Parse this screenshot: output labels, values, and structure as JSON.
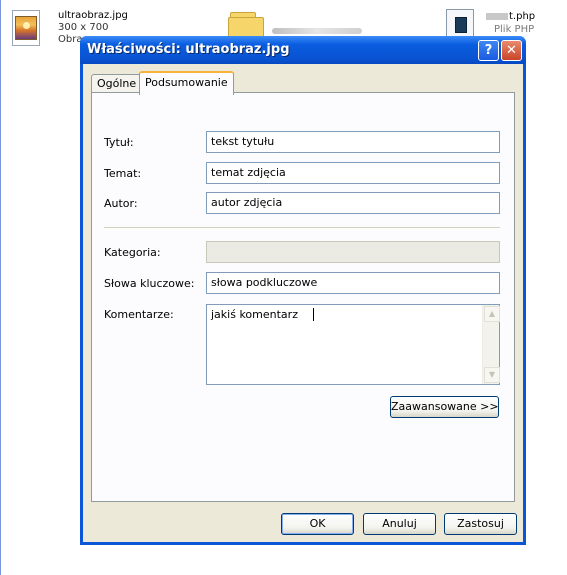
{
  "desktop": {
    "file_name": "ultraobraz.jpg",
    "file_dims": "300 x 700",
    "file_type_partial": "Obra",
    "php_name_visible": "t.php",
    "php_type": "Plik PHP"
  },
  "dialog": {
    "title": "Właściwości: ultraobraz.jpg",
    "help_label": "?",
    "close_label": "✕",
    "tabs": [
      {
        "label": "Ogólne"
      },
      {
        "label": "Podsumowanie"
      }
    ],
    "fields": {
      "title_label": "Tytuł:",
      "title_value": "tekst tytułu",
      "subject_label": "Temat:",
      "subject_value": "temat zdjęcia",
      "author_label": "Autor:",
      "author_value": "autor zdjęcia",
      "category_label": "Kategoria:",
      "category_value": "",
      "keywords_label": "Słowa kluczowe:",
      "keywords_value": "słowa podkluczowe",
      "comments_label": "Komentarze:",
      "comments_value": "jakiś komentarz"
    },
    "advanced_button": "Zaawansowane >>",
    "buttons": {
      "ok": "OK",
      "cancel": "Anuluj",
      "apply": "Zastosuj"
    }
  },
  "colors": {
    "titlebar": "#0a5de0",
    "dialog_bg": "#ece9d8",
    "tab_highlight": "#f7b33a",
    "close_button": "#c9442a"
  }
}
